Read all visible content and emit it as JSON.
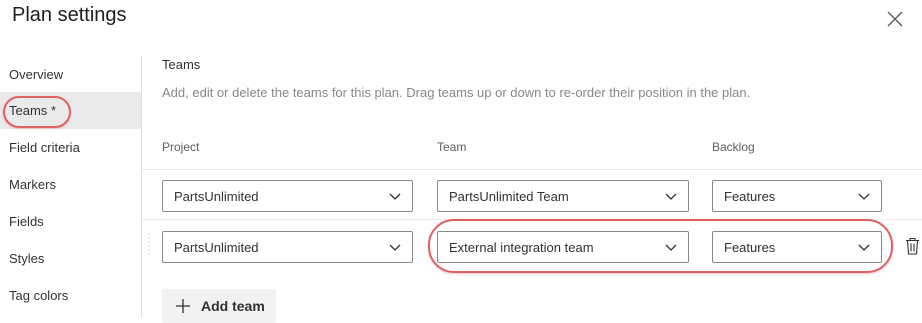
{
  "dialog": {
    "title": "Plan settings",
    "close_icon": "close-icon"
  },
  "sidebar": {
    "items": [
      {
        "label": "Overview"
      },
      {
        "label": "Teams *",
        "active": true
      },
      {
        "label": "Field criteria"
      },
      {
        "label": "Markers"
      },
      {
        "label": "Fields"
      },
      {
        "label": "Styles"
      },
      {
        "label": "Tag colors"
      }
    ]
  },
  "teams_section": {
    "title": "Teams",
    "description": "Add, edit or delete the teams for this plan. Drag teams up or down to re-order their position in the plan.",
    "columns": {
      "project": "Project",
      "team": "Team",
      "backlog": "Backlog"
    },
    "rows": [
      {
        "project": "PartsUnlimited",
        "team": "PartsUnlimited Team",
        "backlog": "Features"
      },
      {
        "project": "PartsUnlimited",
        "team": "External integration team",
        "backlog": "Features"
      }
    ],
    "add_team_label": "Add team"
  },
  "colors": {
    "highlight": "#e06161",
    "active_item_bg": "#eaeaea",
    "field_border": "#8a8886"
  }
}
